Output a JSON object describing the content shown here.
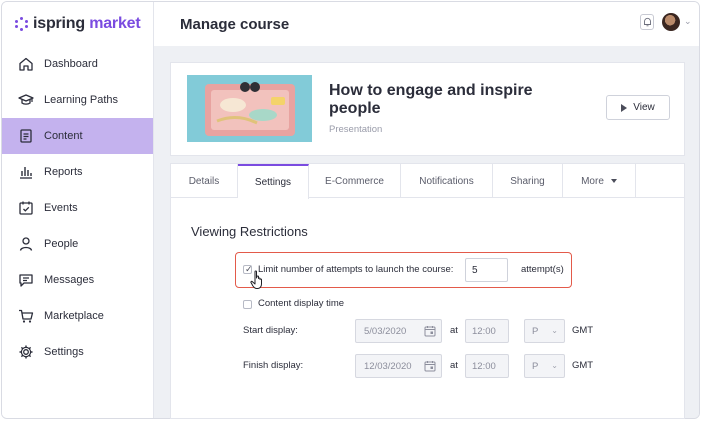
{
  "app": {
    "logo": {
      "part1": "ispring",
      "part2": "market"
    }
  },
  "sidebar": {
    "items": [
      {
        "label": "Dashboard",
        "icon": "home-icon",
        "active": false
      },
      {
        "label": "Learning Paths",
        "icon": "graduation-cap-icon",
        "active": false
      },
      {
        "label": "Content",
        "icon": "document-icon",
        "active": true
      },
      {
        "label": "Reports",
        "icon": "bar-chart-icon",
        "active": false
      },
      {
        "label": "Events",
        "icon": "calendar-check-icon",
        "active": false
      },
      {
        "label": "People",
        "icon": "person-icon",
        "active": false
      },
      {
        "label": "Messages",
        "icon": "message-icon",
        "active": false
      },
      {
        "label": "Marketplace",
        "icon": "cart-icon",
        "active": false
      },
      {
        "label": "Settings",
        "icon": "gear-icon",
        "active": false
      }
    ]
  },
  "header": {
    "title": "Manage course"
  },
  "course": {
    "title": "How to engage and inspire people",
    "type": "Presentation",
    "view_label": "View"
  },
  "tabs": [
    {
      "label": "Details",
      "active": false
    },
    {
      "label": "Settings",
      "active": true
    },
    {
      "label": "E-Commerce",
      "active": false
    },
    {
      "label": "Notifications",
      "active": false
    },
    {
      "label": "Sharing",
      "active": false
    },
    {
      "label": "More",
      "active": false
    }
  ],
  "viewing_restrictions": {
    "title": "Viewing Restrictions",
    "limit_attempts": {
      "label": "Limit number of attempts to launch the course:",
      "checked": true,
      "value": "5",
      "unit": "attempt(s)"
    },
    "content_display_time": {
      "label": "Content display time",
      "checked": false
    },
    "start_display": {
      "label": "Start display:",
      "date": "5/03/2020",
      "at": "at",
      "time": "12:00",
      "ampm": "P",
      "tz": "GMT"
    },
    "finish_display": {
      "label": "Finish display:",
      "date": "12/03/2020",
      "at": "at",
      "time": "12:00",
      "ampm": "P",
      "tz": "GMT"
    }
  },
  "colors": {
    "brand": "#7a4be0",
    "active_nav": "#c4b2ee",
    "highlight": "#e35a4a"
  }
}
